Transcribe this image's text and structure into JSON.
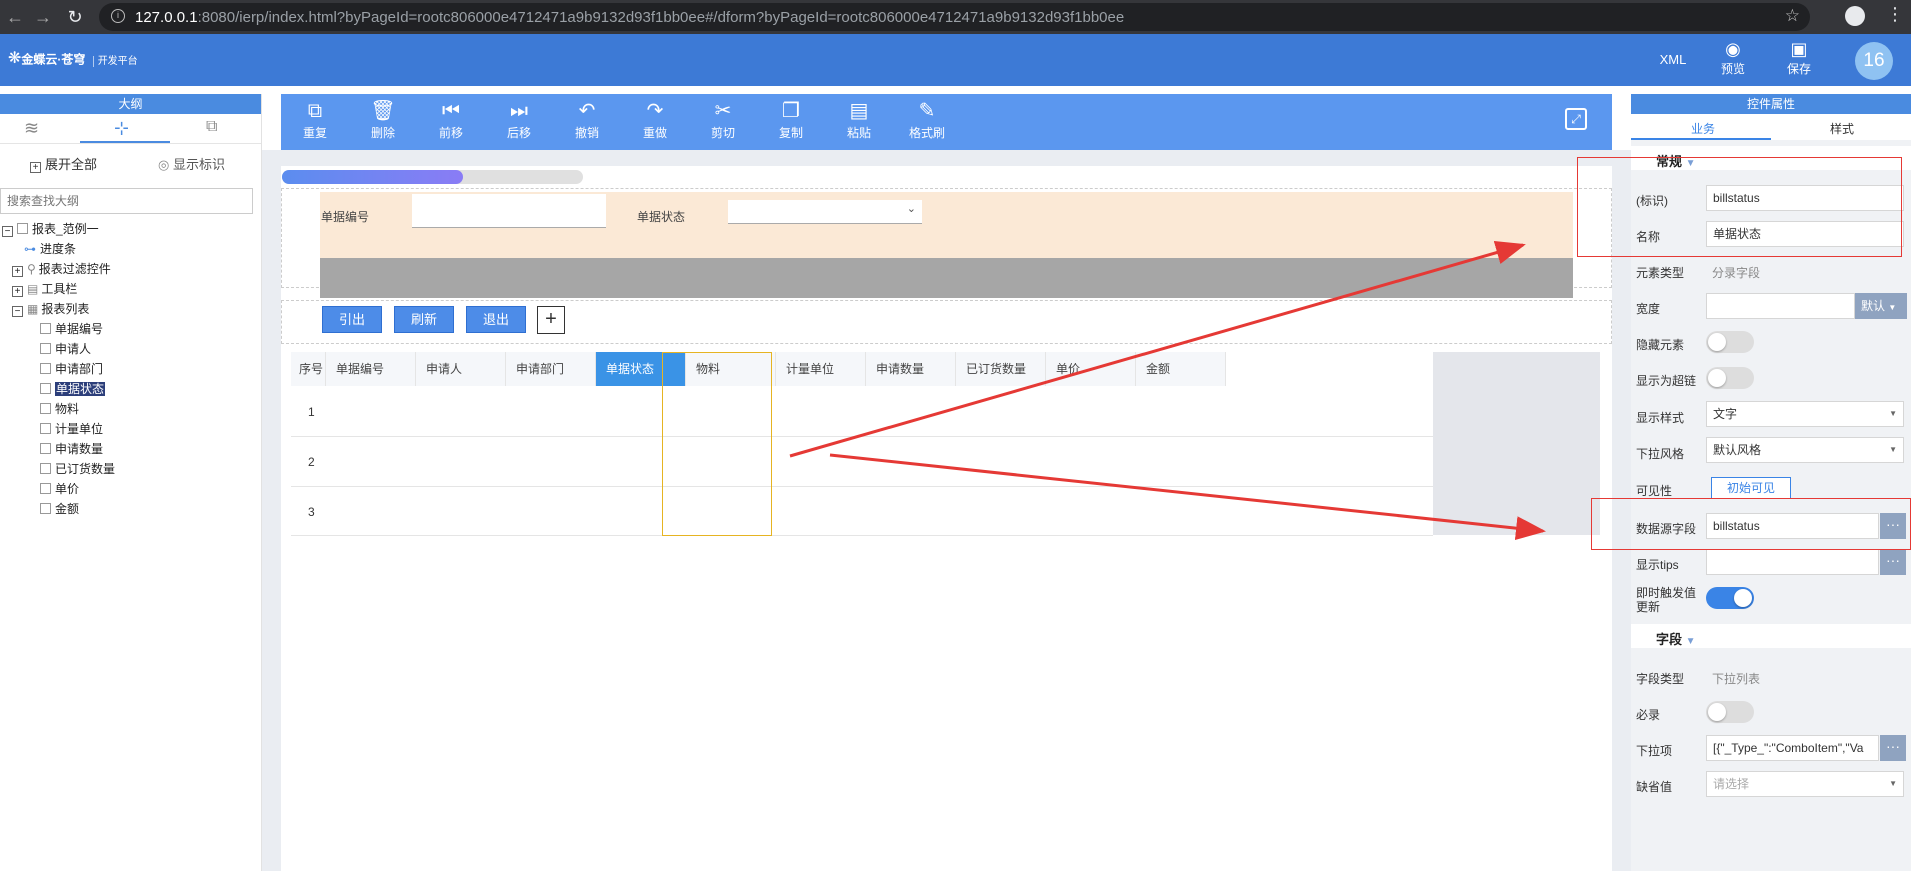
{
  "browser": {
    "url_host": "127.0.0.1",
    "url_rest": ":8080/ierp/index.html?byPageId=rootc806000e4712471a9b9132d93f1bb0ee#/dform?byPageId=rootc806000e4712471a9b9132d93f1bb0ee"
  },
  "header": {
    "logo_text": "金蝶云·苍穹",
    "logo_sub": "开发平台",
    "xml_label": "XML",
    "preview_label": "预览",
    "save_label": "保存",
    "avatar_text": "16"
  },
  "outline": {
    "title": "大纲",
    "expand_all": "展开全部",
    "show_ids": "显示标识",
    "search_placeholder": "搜索查找大纲",
    "tree": {
      "root": "报表_范例一",
      "progress": "进度条",
      "filter": "报表过滤控件",
      "toolbar": "工具栏",
      "report_list": "报表列表",
      "c1": "单据编号",
      "c2": "申请人",
      "c3": "申请部门",
      "c4": "单据状态",
      "c5": "物料",
      "c6": "计量单位",
      "c7": "申请数量",
      "c8": "已订货数量",
      "c9": "单价",
      "c10": "金额"
    }
  },
  "toolbar": {
    "b1": "重复",
    "b2": "删除",
    "b3": "前移",
    "b4": "后移",
    "b5": "撤销",
    "b6": "重做",
    "b7": "剪切",
    "b8": "复制",
    "b9": "粘贴",
    "b10": "格式刷"
  },
  "progress": {
    "value": 0.6
  },
  "filter": {
    "bill_no_label": "单据编号",
    "bill_status_label": "单据状态"
  },
  "buttons": {
    "import": "引出",
    "refresh": "刷新",
    "exit": "退出",
    "add": "+"
  },
  "grid": {
    "columns": [
      "序号",
      "单据编号",
      "申请人",
      "申请部门",
      "单据状态",
      "物料",
      "计量单位",
      "申请数量",
      "已订货数量",
      "单价",
      "金额"
    ],
    "rows": [
      "1",
      "2",
      "3"
    ]
  },
  "props": {
    "title": "控件属性",
    "tab_business": "业务",
    "tab_style": "样式",
    "section_general": "常规",
    "id_label": "(标识)",
    "id_value": "billstatus",
    "name_label": "名称",
    "name_value": "单据状态",
    "elem_type_label": "元素类型",
    "elem_type_value": "分录字段",
    "width_label": "宽度",
    "width_default": "默认",
    "hidden_label": "隐藏元素",
    "hidden_on": false,
    "link_label": "显示为超链",
    "link_on": false,
    "display_style_label": "显示样式",
    "display_style_value": "文字",
    "dropdown_style_label": "下拉风格",
    "dropdown_style_value": "默认风格",
    "visibility_label": "可见性",
    "visibility_value": "初始可见",
    "datasource_label": "数据源字段",
    "datasource_value": "billstatus",
    "tips_label": "显示tips",
    "instant_label_1": "即时触发值",
    "instant_label_2": "更新",
    "instant_on": true,
    "section_field": "字段",
    "field_type_label": "字段类型",
    "field_type_value": "下拉列表",
    "required_label": "必录",
    "required_on": false,
    "items_label": "下拉项",
    "items_value": "[{\"_Type_\":\"ComboItem\",\"Va",
    "default_label": "缺省值",
    "default_placeholder": "请选择",
    "dots": "···"
  },
  "colors": {
    "header_blue": "#3d7ad6",
    "toolbar_blue": "#5b97ef",
    "annotation_red": "#e53935",
    "filter_bg": "#fbe9d6",
    "selected_border": "#e6b422"
  }
}
